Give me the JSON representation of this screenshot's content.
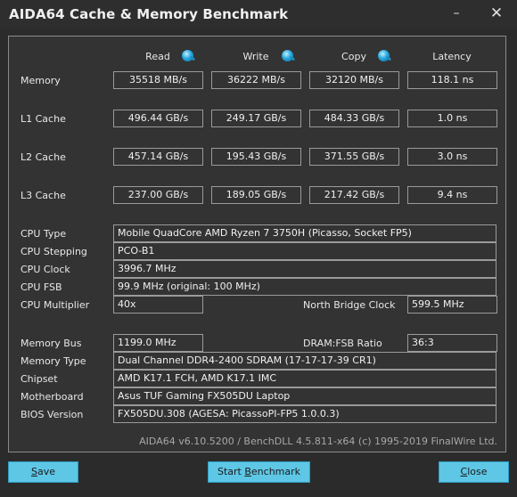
{
  "window": {
    "title": "AIDA64 Cache & Memory Benchmark",
    "minimize_label": "–",
    "close_label": "✕"
  },
  "bench": {
    "columns": [
      "Read",
      "Write",
      "Copy",
      "Latency"
    ],
    "rows": [
      {
        "label": "Memory",
        "read": "35518 MB/s",
        "write": "36222 MB/s",
        "copy": "32120 MB/s",
        "latency": "118.1 ns"
      },
      {
        "label": "L1 Cache",
        "read": "496.44 GB/s",
        "write": "249.17 GB/s",
        "copy": "484.33 GB/s",
        "latency": "1.0 ns"
      },
      {
        "label": "L2 Cache",
        "read": "457.14 GB/s",
        "write": "195.43 GB/s",
        "copy": "371.55 GB/s",
        "latency": "3.0 ns"
      },
      {
        "label": "L3 Cache",
        "read": "237.00 GB/s",
        "write": "189.05 GB/s",
        "copy": "217.42 GB/s",
        "latency": "9.4 ns"
      }
    ]
  },
  "cpu": {
    "type_label": "CPU Type",
    "type_value": "Mobile QuadCore AMD Ryzen 7 3750H  (Picasso, Socket FP5)",
    "stepping_label": "CPU Stepping",
    "stepping_value": "PCO-B1",
    "clock_label": "CPU Clock",
    "clock_value": "3996.7 MHz",
    "fsb_label": "CPU FSB",
    "fsb_value": "99.9 MHz  (original: 100 MHz)",
    "multiplier_label": "CPU Multiplier",
    "multiplier_value": "40x",
    "nb_clock_label": "North Bridge Clock",
    "nb_clock_value": "599.5 MHz"
  },
  "memory": {
    "bus_label": "Memory Bus",
    "bus_value": "1199.0 MHz",
    "dram_fsb_label": "DRAM:FSB Ratio",
    "dram_fsb_value": "36:3",
    "type_label": "Memory Type",
    "type_value": "Dual Channel DDR4-2400 SDRAM  (17-17-17-39 CR1)",
    "chipset_label": "Chipset",
    "chipset_value": "AMD K17.1 FCH, AMD K17.1 IMC",
    "motherboard_label": "Motherboard",
    "motherboard_value": "Asus TUF Gaming FX505DU Laptop",
    "bios_label": "BIOS Version",
    "bios_value": "FX505DU.308  (AGESA: PicassoPI-FP5 1.0.0.3)"
  },
  "footer": {
    "version_text": "AIDA64 v6.10.5200 / BenchDLL 4.5.811-x64  (c) 1995-2019 FinalWire Ltd."
  },
  "buttons": {
    "save_first": "S",
    "save_rest": "ave",
    "start_prefix": "Start ",
    "start_u": "B",
    "start_rest": "enchmark",
    "close_first": "C",
    "close_rest": "lose"
  },
  "colors": {
    "accent_button": "#5ec7e6",
    "background": "#2b2b2b"
  }
}
